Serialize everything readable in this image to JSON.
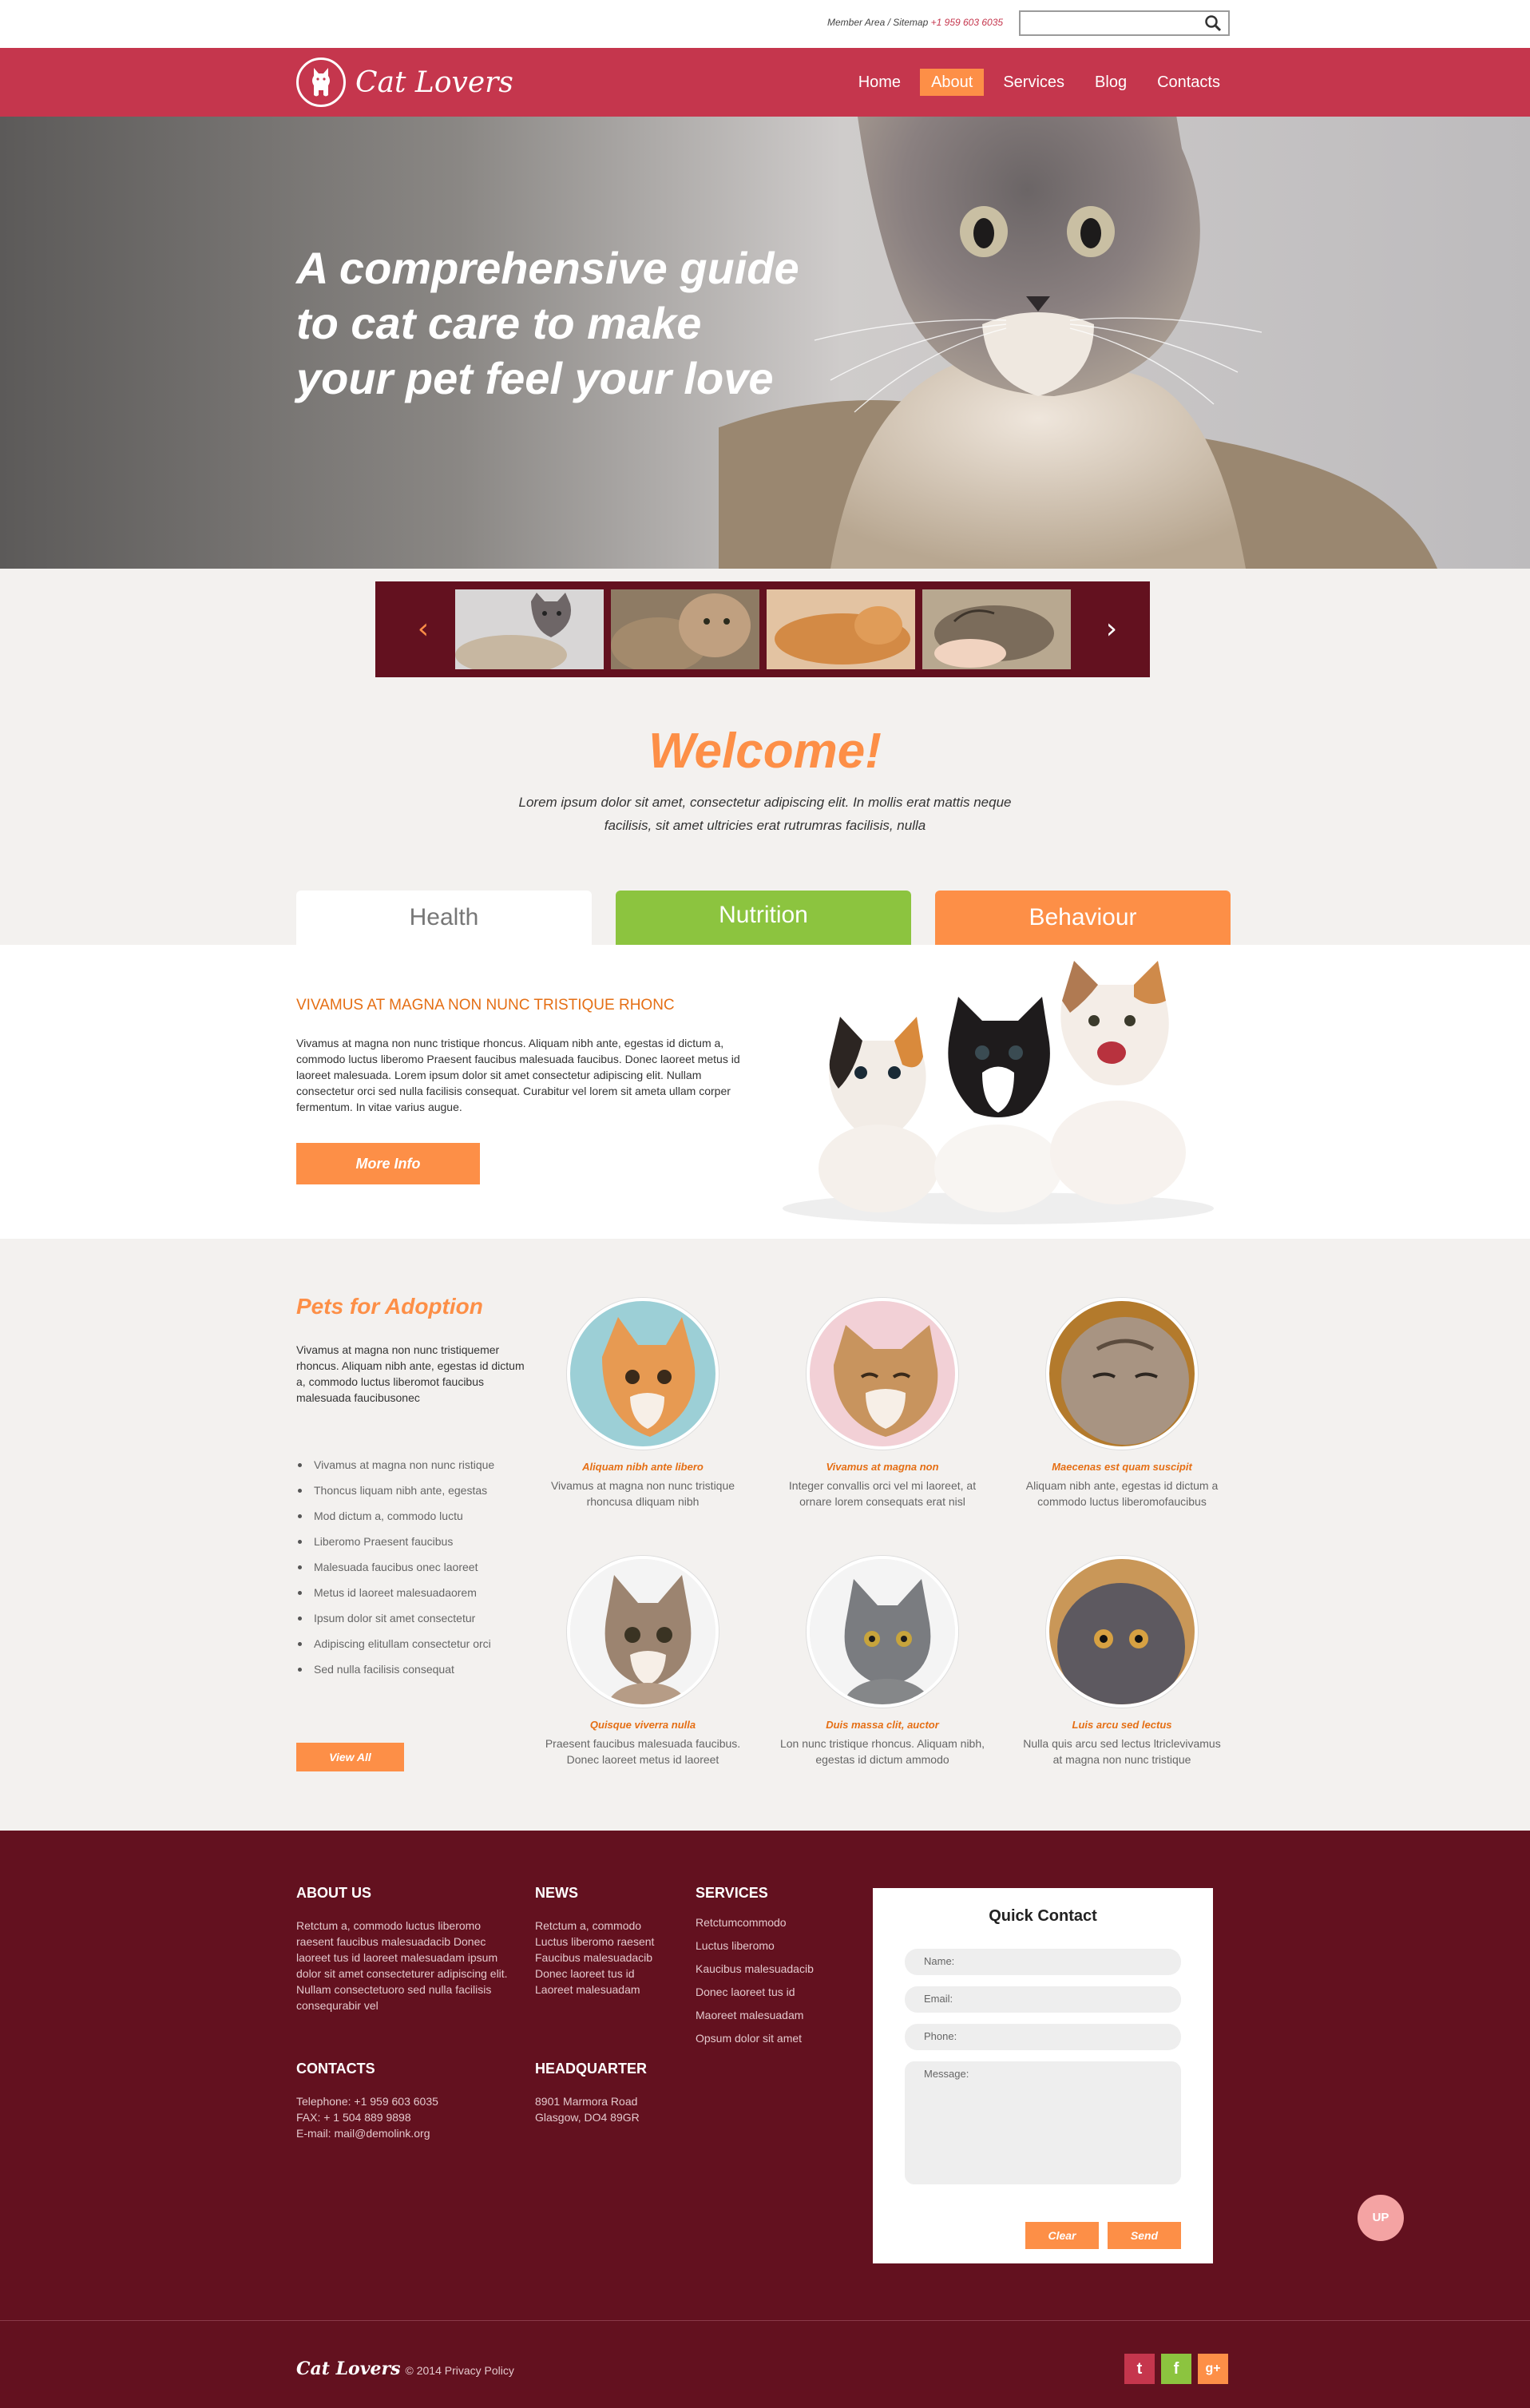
{
  "topbar": {
    "member_area": "Member Area / Sitemap",
    "phone": "+1 959 603 6035",
    "search_placeholder": ""
  },
  "brand": {
    "name": "Cat Lovers"
  },
  "nav": {
    "items": [
      "Home",
      "About",
      "Services",
      "Blog",
      "Contacts"
    ],
    "active": "About"
  },
  "hero": {
    "headline": "A comprehensive guide to cat care to make your pet feel your love"
  },
  "carousel": {
    "prev": "‹",
    "next": "›"
  },
  "welcome": {
    "title": "Welcome!",
    "text": "Lorem ipsum dolor sit amet, consectetur adipiscing elit. In mollis erat mattis neque facilisis, sit amet ultricies erat rutrumras facilisis, nulla"
  },
  "tabs": {
    "health": "Health",
    "nutrition": "Nutrition",
    "behaviour": "Behaviour"
  },
  "tab_panel": {
    "heading": "VIVAMUS AT MAGNA NON NUNC TRISTIQUE RHONC",
    "text": "Vivamus at magna non nunc tristique rhoncus. Aliquam nibh ante, egestas id dictum a, commodo luctus liberomo Praesent faucibus malesuada faucibus. Donec laoreet metus id laoreet malesuada. Lorem ipsum dolor sit amet consectetur adipiscing elit. Nullam consectetur orci sed nulla facilisis consequat. Curabitur vel lorem sit ameta ullam corper fermentum. In vitae varius augue.",
    "button": "More Info"
  },
  "adoption": {
    "title": "Pets for Adoption",
    "intro": "Vivamus at magna non nunc tristiquemer rhoncus. Aliquam nibh ante, egestas id dictum a, commodo luctus liberomot faucibus malesuada faucibusonec",
    "list": [
      "Vivamus at magna non nunc ristique",
      "Thoncus liquam nibh ante, egestas",
      "Mod dictum a, commodo luctu",
      "Liberomo Praesent faucibus",
      "Malesuada faucibus onec laoreet",
      "Metus id laoreet malesuadaorem",
      "Ipsum dolor sit amet consectetur",
      "Adipiscing elitullam consectetur orci",
      "Sed nulla facilisis consequat"
    ],
    "button": "View All",
    "pets": [
      {
        "name": "Aliquam nibh ante libero",
        "desc": "Vivamus at magna non nunc tristique rhoncusa dliquam nibh"
      },
      {
        "name": "Vivamus at magna non",
        "desc": "Integer convallis orci vel mi laoreet, at ornare lorem consequats erat nisl"
      },
      {
        "name": "Maecenas est quam suscipit",
        "desc": "Aliquam nibh ante, egestas id dictum a commodo luctus liberomofaucibus"
      },
      {
        "name": "Quisque viverra nulla",
        "desc": "Praesent faucibus malesuada faucibus. Donec laoreet metus id laoreet"
      },
      {
        "name": "Duis massa clit, auctor",
        "desc": "Lon nunc tristique rhoncus. Aliquam nibh, egestas id dictum ammodo"
      },
      {
        "name": "Luis arcu sed lectus",
        "desc": "Nulla quis arcu sed lectus ltriclevivamus at magna non nunc tristique"
      }
    ]
  },
  "footer": {
    "about": {
      "title": "ABOUT US",
      "text": "Retctum a, commodo luctus liberomo raesent faucibus malesuadacib Donec laoreet tus id laoreet malesuadam ipsum dolor sit amet consecteturer adipiscing elit. Nullam consectetuoro sed nulla facilisis consequrabir vel"
    },
    "news": {
      "title": "NEWS",
      "text": "Retctum a, commodo Luctus liberomo raesent Faucibus malesuadacib Donec laoreet tus id Laoreet malesuadam"
    },
    "services": {
      "title": "SERVICES",
      "links": [
        "Retctumcommodo",
        "Luctus liberomo",
        "Kaucibus malesuadacib",
        "Donec laoreet tus id",
        "Maoreet malesuadam",
        "Opsum dolor sit amet"
      ]
    },
    "contacts": {
      "title": "CONTACTS",
      "telephone": "Telephone: +1 959 603 6035",
      "fax": "FAX: + 1 504 889 9898",
      "email": "E-mail: mail@demolink.org"
    },
    "hq": {
      "title": "HEADQUARTER",
      "address1": "8901 Marmora Road",
      "address2": "Glasgow, DO4 89GR"
    },
    "quick_contact": {
      "title": "Quick Contact",
      "name": "Name:",
      "email": "Email:",
      "phone": "Phone:",
      "message": "Message:",
      "clear": "Clear",
      "send": "Send"
    },
    "up": "UP",
    "copyright": "© 2014 Privacy Policy",
    "social": {
      "twitter": "t",
      "facebook": "f",
      "gplus": "g+"
    }
  },
  "colors": {
    "brand_red": "#c5364d",
    "accent_orange": "#fd8f47",
    "nutrition_green": "#8cc43f",
    "footer_maroon": "#63111f"
  }
}
